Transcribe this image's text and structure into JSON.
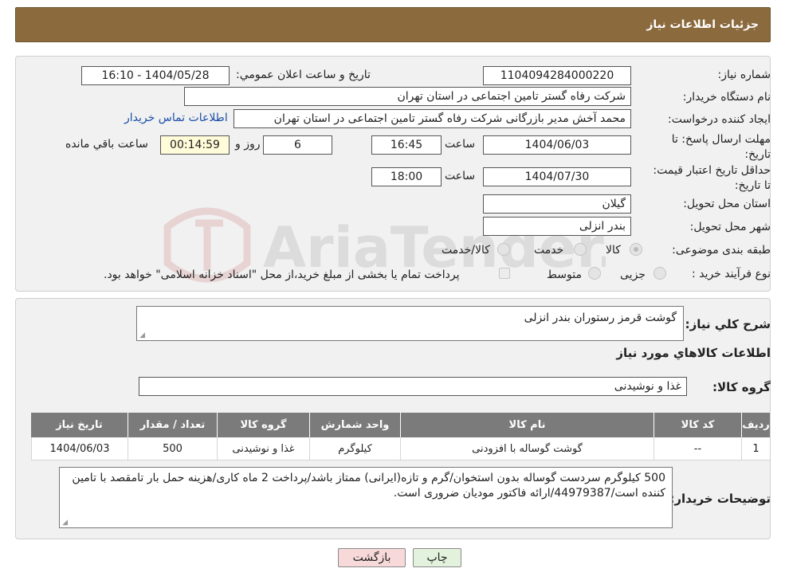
{
  "header": {
    "title": "جزئیات اطلاعات نیاز"
  },
  "watermark": {
    "text": "AriaTender.neT"
  },
  "info": {
    "need_number_label": "شماره نیاز:",
    "need_number": "1104094284000220",
    "announce_label": "تاریخ و ساعت اعلان عمومي:",
    "announce_value": "1404/05/28 - 16:10",
    "buyer_org_label": "نام دستگاه خریدار:",
    "buyer_org": "شرکت رفاه گستر تامین اجتماعی در استان تهران",
    "requester_label": "ایجاد کننده درخواست:",
    "requester": "محمد آخش مدیر بازرگانی شرکت رفاه گستر تامین اجتماعی در استان تهران",
    "contact_link": "اطلاعات تماس خریدار",
    "deadline_label": "مهلت ارسال پاسخ: تا تاریخ:",
    "deadline_date": "1404/06/03",
    "time_label": "ساعت",
    "deadline_time": "16:45",
    "days_value": "6",
    "days_label": "روز و",
    "remaining_time": "00:14:59",
    "remaining_label": "ساعت باقي مانده",
    "validity_label": "حداقل تاریخ اعتبار قیمت: تا تاریخ:",
    "validity_date": "1404/07/30",
    "validity_time": "18:00",
    "province_label": "استان محل تحویل:",
    "province": "گیلان",
    "city_label": "شهر محل تحویل:",
    "city": "بندر انزلی",
    "category_label": "طبقه بندی موضوعی:",
    "category_options": [
      "کالا",
      "خدمت",
      "کالا/خدمت"
    ],
    "process_label": "نوع فرآیند خرید :",
    "process_options": [
      "جزیی",
      "متوسط"
    ],
    "process_note": "پرداخت تمام یا بخشی از مبلغ خرید،از محل \"اسناد خزانه اسلامی\" خواهد بود."
  },
  "details": {
    "summary_label": "شرح کلي نياز:",
    "summary": "گوشت قرمز رستوران بندر انزلی",
    "goods_info_title": "اطلاعات کالاهاي مورد نياز",
    "goods_group_label": "گروه کالا:",
    "goods_group": "غذا و نوشیدنی",
    "table_headers": [
      "رديف",
      "کد کالا",
      "نام کالا",
      "واحد شمارش",
      "گروه کالا",
      "تعداد / مقدار",
      "تاريخ نياز"
    ],
    "rows": [
      [
        "1",
        "--",
        "گوشت گوساله با افزودنی",
        "کیلوگرم",
        "غذا و نوشیدنی",
        "500",
        "1404/06/03"
      ]
    ],
    "buyer_notes_label": "توضيحات خريدار:",
    "buyer_notes": "500 کیلوگرم سردست گوساله بدون استخوان/گرم و تازه(ایرانی) ممتاز باشد/پرداخت 2 ماه کاری/هزینه حمل بار تامقصد با تامین کننده است/44979387/ارائه فاکتور مودیان ضروری است."
  },
  "buttons": {
    "print": "چاپ",
    "back": "بازگشت"
  },
  "colors": {
    "header_bg": "#8b6a3e",
    "table_header_bg": "#7b7b7b",
    "back_button_bg": "#f7d9d9",
    "print_button_bg": "#e2f2dc"
  }
}
